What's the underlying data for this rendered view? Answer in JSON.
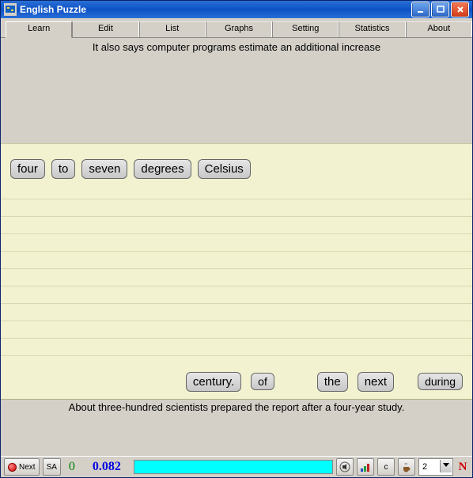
{
  "window": {
    "title": "English Puzzle"
  },
  "tabs": {
    "items": [
      "Learn",
      "Edit",
      "List",
      "Graphs",
      "Setting",
      "Statistics",
      "About"
    ],
    "active_index": 0
  },
  "question": "It also says computer programs estimate an additional increase",
  "placed_words": [
    "four",
    "to",
    "seven",
    "degrees",
    "Celsius"
  ],
  "pool_words": [
    "century.",
    "of",
    "the",
    "next",
    "during"
  ],
  "answer": "About three-hundred scientists prepared the report after a four-year study.",
  "status": {
    "next_label": "Next",
    "sa_label": "SA",
    "green_number": "0",
    "blue_number": "0.082",
    "c_label": "c",
    "select_value": "2",
    "mode_letter": "N"
  }
}
